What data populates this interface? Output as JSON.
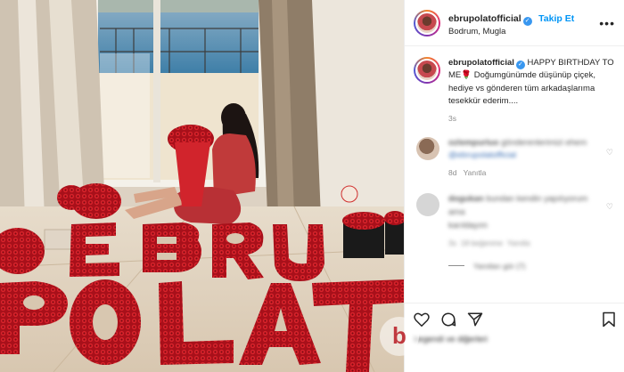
{
  "post": {
    "username": "ebrupolatofficial",
    "follow_label": "Takip Et",
    "location": "Bodrum, Mugla",
    "verified_glyph": "✓",
    "more_glyph": "•••"
  },
  "caption": {
    "username": "ebrupolatofficial",
    "text": "HAPPY BIRTHDAY TO ME🌹 Doğumgünümde düşünüp çiçek, hediye vs gönderen tüm arkadaşlarıma tesekkür ederim....",
    "timestamp": "3s"
  },
  "comments": [
    {
      "username": "ozlempurluo",
      "text": "@ebrupolatofficial",
      "time": "8d",
      "reply_label": "Yanıtla",
      "avatar_color": "#b59a86"
    },
    {
      "username": "dogukan",
      "text": "karıldayım",
      "time": "3s",
      "likes": "18 beğenme",
      "reply_label": "Yanıtla",
      "avatar_color": "#cfcfcf"
    }
  ],
  "view_replies_label": "Yanıtları gör (7)",
  "icons": [
    "heart-icon",
    "comment-icon",
    "share-icon",
    "bookmark-icon"
  ],
  "watermark": "b",
  "letters": [
    "E",
    "B",
    "R",
    "U",
    "P",
    "O",
    "L",
    "A",
    "T"
  ],
  "colors": {
    "accent": "#0095f6",
    "verified": "#3897f0",
    "roses": "#c4181e"
  }
}
